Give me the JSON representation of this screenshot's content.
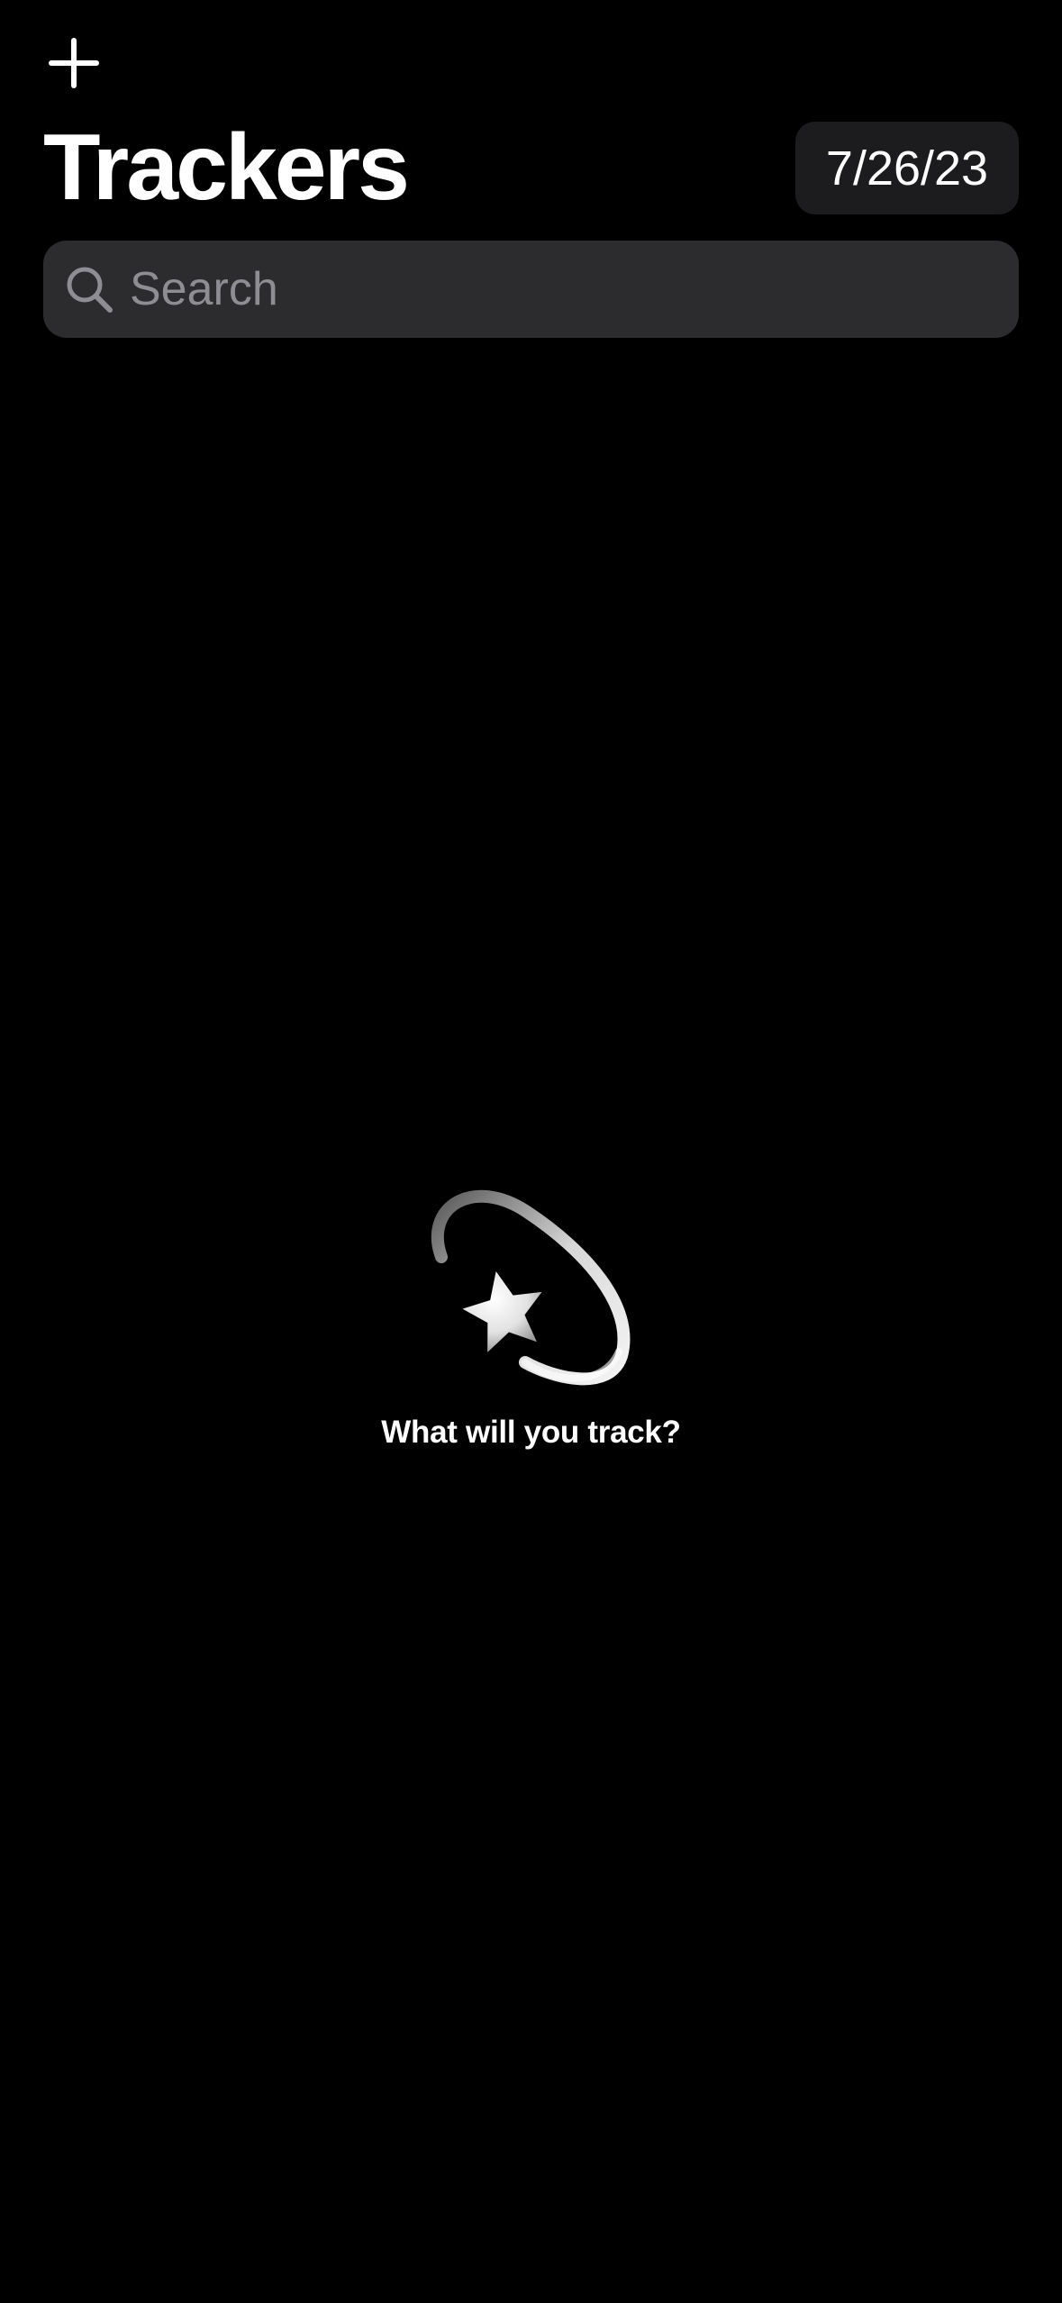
{
  "header": {
    "add_icon": "plus-icon",
    "title": "Trackers",
    "date_label": "7/26/23"
  },
  "search": {
    "icon": "magnifying-glass-icon",
    "placeholder": "Search",
    "value": ""
  },
  "empty_state": {
    "icon": "dizzy-star-icon",
    "message": "What will you track?"
  },
  "colors": {
    "background": "#000000",
    "date_button_bg": "#1c1c1e",
    "search_bg": "#2c2c2e",
    "placeholder": "#8d8d93",
    "text": "#ffffff"
  }
}
